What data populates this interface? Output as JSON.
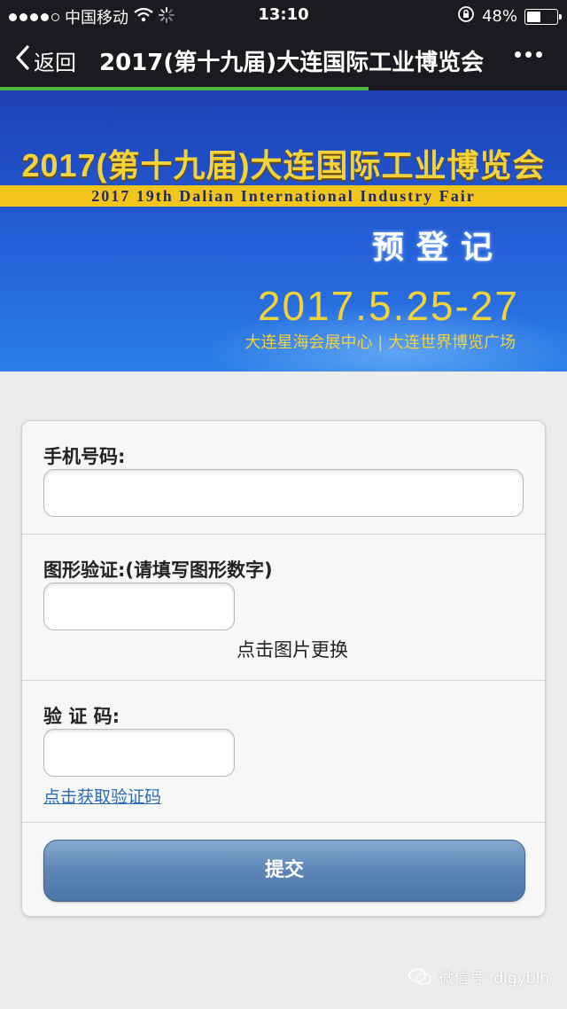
{
  "status_bar": {
    "carrier": "中国移动",
    "time": "13:10",
    "battery_percent": "48%",
    "battery_level": 0.48
  },
  "nav": {
    "back_label": "返回",
    "title": "2017(第十九届)大连国际工业博览会"
  },
  "page_progress": 0.65,
  "banner": {
    "title": "2017(第十九届)大连国际工业博览会",
    "strip_text": "2017 19th Dalian International Industry Fair",
    "subtitle": "预登记",
    "date": "2017.5.25-27",
    "venue": "大连星海会展中心 | 大连世界博览广场",
    "colors": {
      "gold": "#f4d23a",
      "blue_top": "#1d3fb3",
      "blue_bottom": "#2a7ee8"
    }
  },
  "form": {
    "phone_label": "手机号码:",
    "phone_value": "",
    "captcha_label": "图形验证:(请填写图形数字)",
    "captcha_value": "",
    "captcha_refresh": "点击图片更换",
    "sms_label": "验 证 码:",
    "sms_value": "",
    "sms_get": "点击获取验证码",
    "submit": "提交"
  },
  "watermark": {
    "text": "微信号: dlgyblh"
  },
  "colors": {
    "nav_bg": "#1b1b1f",
    "progress": "#4fb83e",
    "link": "#2b6cb8",
    "button": "#5c86b6"
  }
}
